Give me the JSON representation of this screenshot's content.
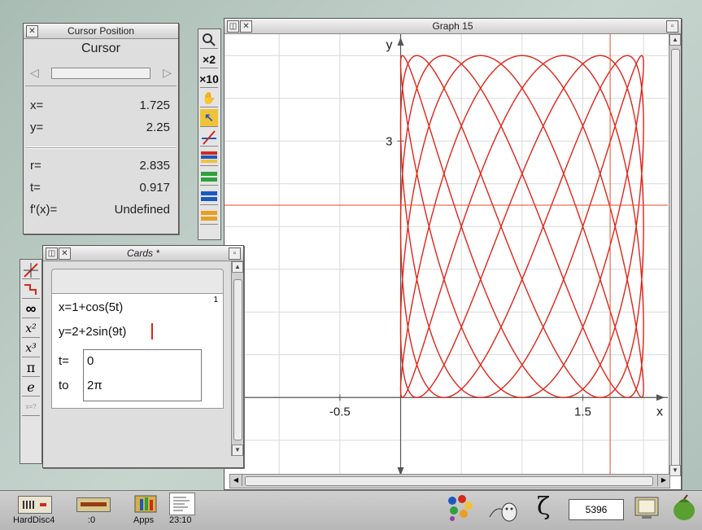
{
  "cursor_window": {
    "title": "Cursor Position",
    "heading": "Cursor",
    "rows": [
      {
        "label": "x=",
        "value": "1.725"
      },
      {
        "label": "y=",
        "value": "2.25"
      },
      {
        "label": "r=",
        "value": "2.835"
      },
      {
        "label": "t=",
        "value": "0.917"
      },
      {
        "label": "f'(x)=",
        "value": "Undefined"
      }
    ]
  },
  "graph_window": {
    "title": "Graph  15",
    "y_axis_label": "y",
    "x_axis_label": "x",
    "tick_labels": {
      "x_neg": "-0.5",
      "x_pos": "1.5",
      "y_pos": "3"
    }
  },
  "toolbar": {
    "zoom2_label": "×2",
    "zoom10_label": "×10"
  },
  "cards_window": {
    "title": "Cards *",
    "card_number": "1",
    "eq1": "x=1+cos(5t)",
    "eq2": "y=2+2sin(9t)",
    "t_label": "t=",
    "t_from": "0",
    "to_label": "to",
    "t_to": "2π"
  },
  "side_tools": {
    "pi": "π",
    "e": "e",
    "x2": "x²",
    "x3": "x³"
  },
  "taskbar": {
    "harddisc_label": "HardDisc4",
    "ram_label": ":0",
    "apps_label": "Apps",
    "time_label": "23:10",
    "memory_value": "5396"
  },
  "colors": {
    "curve": "#e02418",
    "cursor_crosshair": "#e84a2a",
    "grid": "#d9d9d9"
  },
  "chart_data": {
    "type": "line",
    "title": "Graph  15",
    "xlabel": "x",
    "ylabel": "y",
    "parametric": {
      "x": "1+cos(5t)",
      "y": "2+2sin(9t)",
      "t_range": [
        0,
        6.2832
      ]
    },
    "xlim": [
      -1.45,
      2.2
    ],
    "ylim": [
      -0.95,
      4.25
    ],
    "tick_labels": [
      "-0.5",
      "1.5",
      "3"
    ],
    "cursor": {
      "x": 1.725,
      "y": 2.25
    },
    "grid": true
  }
}
